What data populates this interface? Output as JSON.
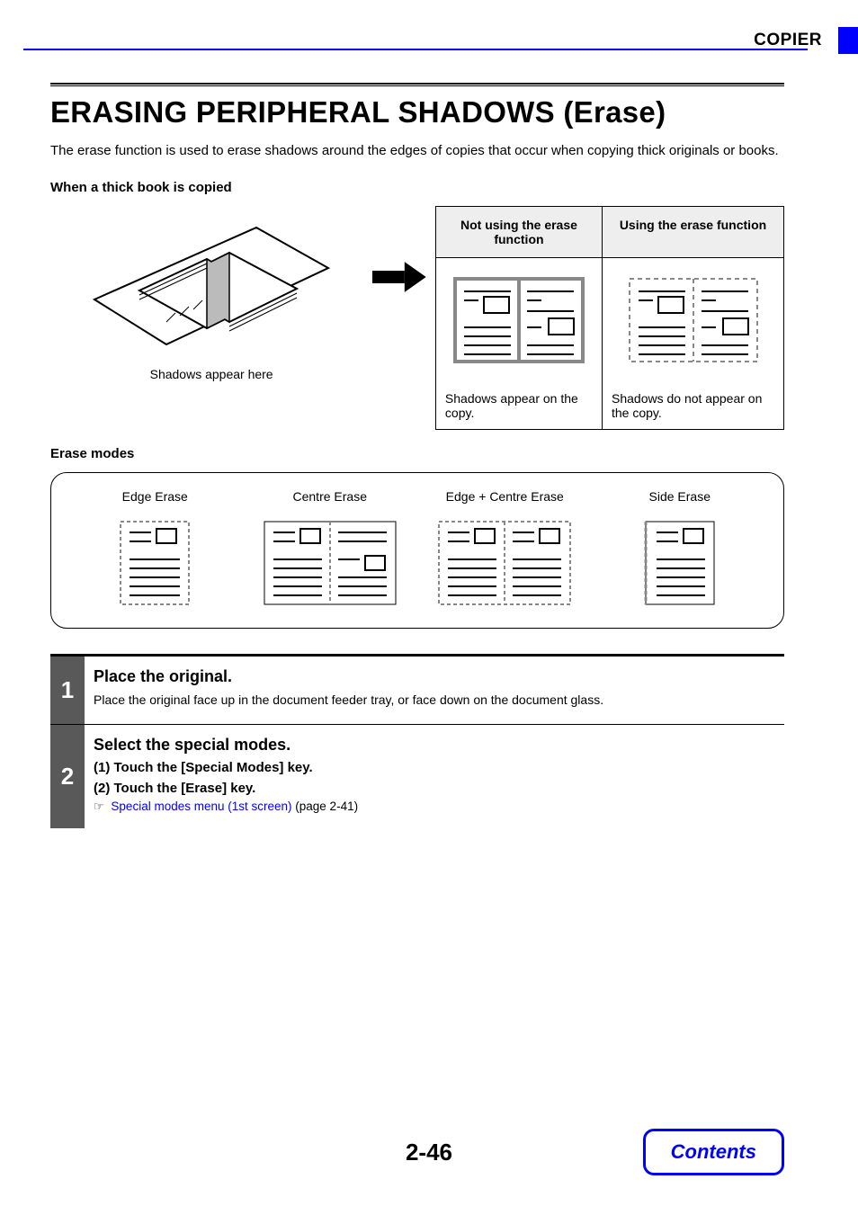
{
  "header": {
    "section": "COPIER"
  },
  "title": "ERASING PERIPHERAL SHADOWS (Erase)",
  "intro": "The erase function is used to erase shadows around the edges of copies that occur when copying thick originals or books.",
  "scenario_label": "When a thick book is copied",
  "book_caption": "Shadows appear here",
  "compare": {
    "col1_header": "Not using the erase function",
    "col2_header": "Using the erase function",
    "col1_caption": "Shadows appear on the copy.",
    "col2_caption": "Shadows do not appear on the copy."
  },
  "modes_label": "Erase modes",
  "modes": [
    {
      "label": "Edge Erase"
    },
    {
      "label": "Centre Erase"
    },
    {
      "label": "Edge + Centre Erase"
    },
    {
      "label": "Side Erase"
    }
  ],
  "steps": [
    {
      "num": "1",
      "title": "Place the original.",
      "text": "Place the original face up in the document feeder tray, or face down on the document glass."
    },
    {
      "num": "2",
      "title": "Select the special modes.",
      "substeps": [
        "(1)   Touch the [Special Modes] key.",
        "(2)   Touch the [Erase] key."
      ],
      "link_text": "Special modes menu (1st screen)",
      "link_pageref": "(page 2-41)"
    }
  ],
  "page_number": "2-46",
  "contents_label": "Contents"
}
